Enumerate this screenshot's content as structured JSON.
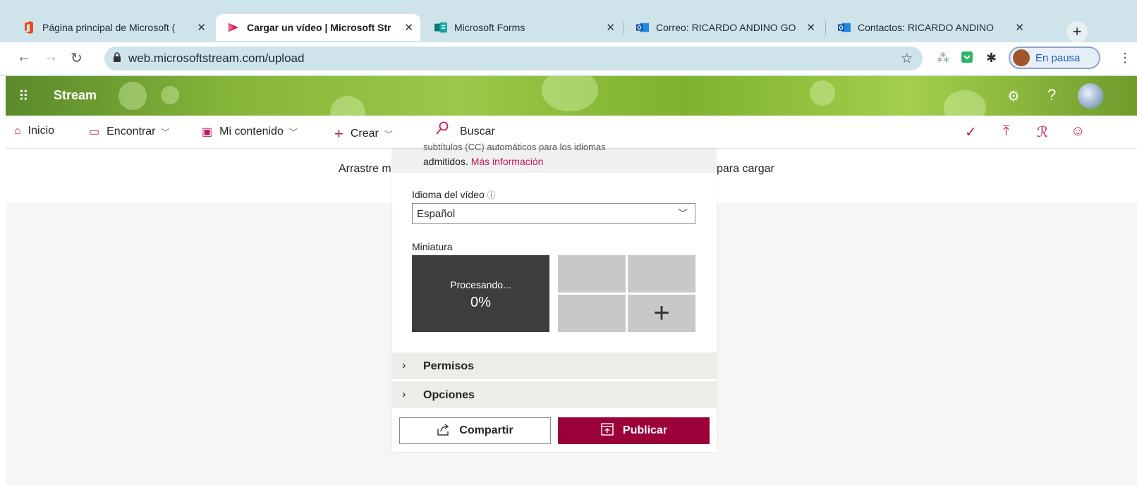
{
  "browser": {
    "tabs": [
      {
        "title": "Página principal de Microsoft (",
        "favicon": "office-icon",
        "active": false
      },
      {
        "title": "Cargar un vídeo | Microsoft Str",
        "favicon": "stream-icon",
        "active": true
      },
      {
        "title": "Microsoft Forms",
        "favicon": "forms-icon",
        "active": false
      },
      {
        "title": "Correo: RICARDO ANDINO GO",
        "favicon": "outlook-icon",
        "active": false
      },
      {
        "title": "Contactos: RICARDO ANDINO",
        "favicon": "outlook-icon",
        "active": false
      }
    ],
    "tab_close": "✕",
    "new_tab": "+",
    "url": "web.microsoftstream.com/upload",
    "profile_status": "En pausa"
  },
  "stream": {
    "brand": "Stream"
  },
  "nav": {
    "items": [
      {
        "label": "Inicio",
        "icon": "home-icon"
      },
      {
        "label": "Encontrar",
        "icon": "discover-icon"
      },
      {
        "label": "Mi contenido",
        "icon": "my-content-icon"
      },
      {
        "label": "Crear",
        "icon": "plus-icon"
      }
    ],
    "search_label": "Buscar"
  },
  "upload": {
    "drag_text_left": "Arrastre m",
    "drag_text_right": "para cargar",
    "info_cut": "subtítulos (CC) automáticos para los idiomas",
    "info_text": "admitidos.",
    "info_link": "Más información",
    "language_label": "Idioma del vídeo",
    "language_value": "Español",
    "thumbnail_label": "Miniatura",
    "processing_label": "Procesando...",
    "processing_percent": "0%",
    "permissions_label": "Permisos",
    "options_label": "Opciones",
    "share_label": "Compartir",
    "publish_label": "Publicar"
  },
  "colors": {
    "accent": "#c2185b",
    "publish_bg": "#9b0038",
    "chrome_bg": "#cfe3ea"
  }
}
